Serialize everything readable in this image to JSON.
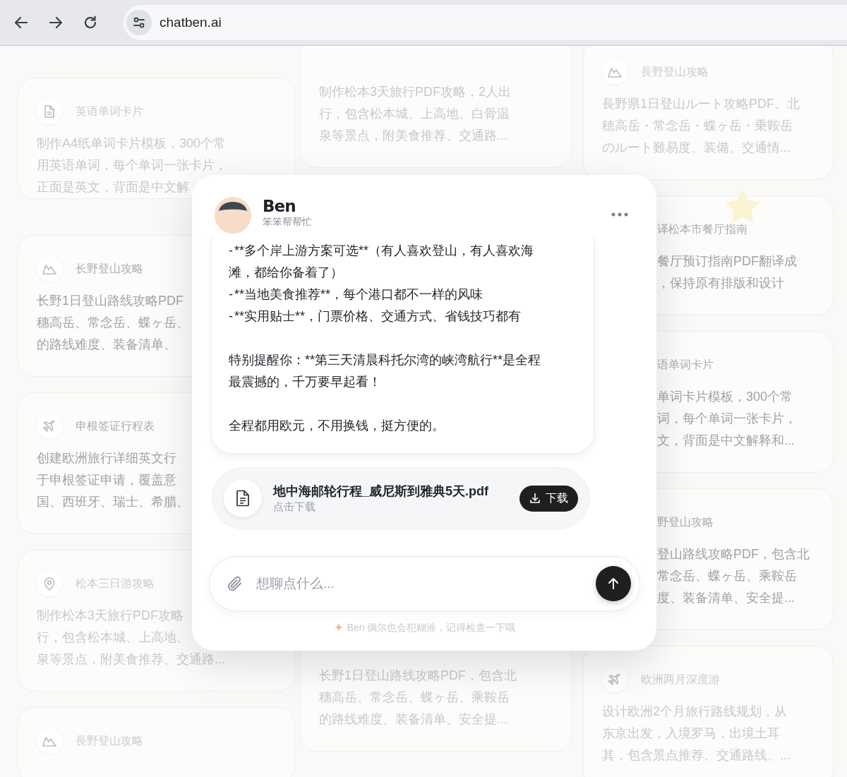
{
  "browser": {
    "url": "chatben.ai"
  },
  "background_cards": {
    "columns": [
      [
        {
          "kind": "document",
          "title": "英语单词卡片",
          "lines": [
            "制作A4纸单词卡片模板，300个常",
            "用英语单词，每个单词一张卡片，",
            "正面是英文，背面是中文解"
          ]
        },
        {
          "kind": "mountain",
          "title": "长野登山攻略",
          "lines": [
            "长野1日登山路线攻略PDF",
            "穗高岳、常念岳、蝶ヶ岳、",
            "的路线难度、装备清单、"
          ]
        },
        {
          "kind": "plane",
          "title": "申根签证行程表",
          "lines": [
            "创建欧洲旅行详细英文行",
            "于申根签证申请，覆盖意",
            "国、西班牙、瑞士、希腊、"
          ]
        },
        {
          "kind": "pin",
          "title": "松本三日游攻略",
          "lines": [
            "制作松本3天旅行PDF攻略",
            "行，包含松本城、上高地、",
            "泉等景点，附美食推荐、交通路..."
          ]
        },
        {
          "kind": "mountain",
          "title": "長野登山攻略"
        }
      ],
      [
        {
          "lines": [
            "制作松本3天旅行PDF攻略，2人出",
            "行，包含松本城、上高地、白骨温",
            "泉等景点，附美食推荐、交通路..."
          ]
        },
        {
          "lines": [
            "长野1日登山路线攻略PDF，包含北",
            "穗高岳、常念岳、蝶ヶ岳、乘鞍岳",
            "的路线难度、装备清单、安全提..."
          ]
        }
      ],
      [
        {
          "kind": "mountain",
          "title": "長野登山攻略",
          "lines": [
            "長野県1日登山ルート攻略PDF、北",
            "穂高岳・常念岳・蝶ヶ岳・乗鞍岳",
            "のルート難易度、装備、交通情..."
          ]
        },
        {
          "title": "译松本市餐厅指南",
          "lines": [
            "餐厅预订指南PDF翻译成",
            "，保持原有排版和设计"
          ]
        },
        {
          "title": "语单词卡片",
          "lines": [
            "单词卡片模板，300个常",
            "词，每个单词一张卡片，",
            "文，背面是中文解释和..."
          ]
        },
        {
          "title": "野登山攻略",
          "lines": [
            "登山路线攻略PDF，包含北",
            "常念岳、蝶ヶ岳、乘鞍岳",
            "度、装备清单、安全提..."
          ]
        },
        {
          "kind": "plane",
          "title": "欧洲两月深度游",
          "lines": [
            "设计欧洲2个月旅行路线规划，从",
            "东京出发，入境罗马，出境土耳",
            "其，包含景点推荐、交通路线、..."
          ]
        }
      ]
    ]
  },
  "chat": {
    "assistant": {
      "name": "Ben",
      "tagline": "笨笨帮帮忙"
    },
    "message": {
      "paragraphs": [
        [
          "- **多个岸上游方案可选**（有人喜欢登山，有人喜欢海滩，都给你备着了）",
          "- **当地美食推荐**，每个港口都不一样的风味",
          "- **实用贴士**，门票价格、交通方式、省钱技巧都有"
        ],
        [
          "特别提醒你：**第三天清晨科托尔湾的峡湾航行**是全程最震撼的，千万要早起看！"
        ],
        [
          "全程都用欧元，不用换钱，挺方便的。"
        ]
      ]
    },
    "attachment": {
      "filename": "地中海邮轮行程_威尼斯到雅典5天.pdf",
      "hint": "点击下载",
      "button": "下载"
    },
    "composer": {
      "placeholder": "想聊点什么..."
    },
    "disclaimer": "Ben 偶尔也会犯糊涂，记得检查一下哦"
  }
}
